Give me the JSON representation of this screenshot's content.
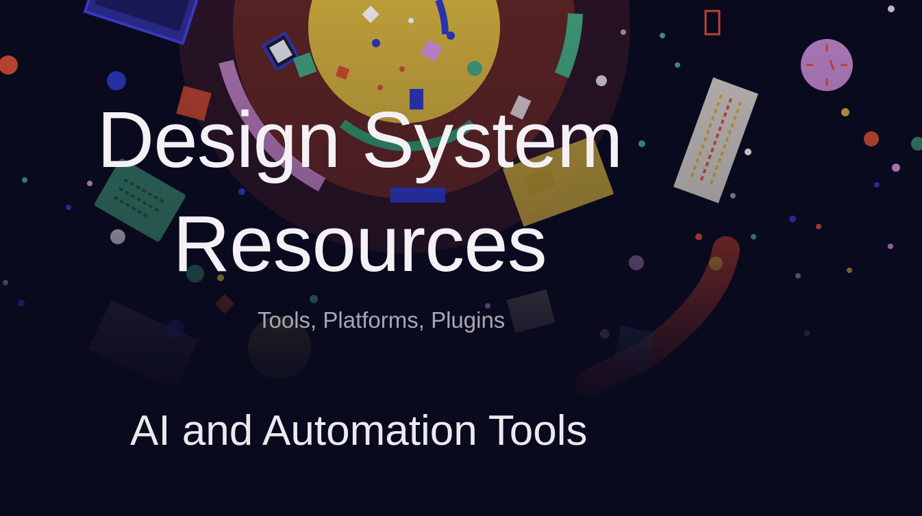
{
  "hero": {
    "title_line_1": "Design System",
    "title_line_2": "Resources",
    "subtitle": "Tools, Platforms, Plugins"
  },
  "section": {
    "heading": "AI and Automation Tools"
  },
  "colors": {
    "background": "#0a0a1e",
    "title_text": "#f4f1f6",
    "subtitle_text": "#a9a7b3",
    "art_outer_ring": "#3d1c2e",
    "art_middle_ring": "#7a2e2a",
    "art_inner_disc": "#c9a93a",
    "art_accent_green": "#3f9a78",
    "art_accent_pink": "#c98bd0",
    "art_accent_blue": "#2a35b8",
    "art_accent_orange": "#d8552f"
  }
}
